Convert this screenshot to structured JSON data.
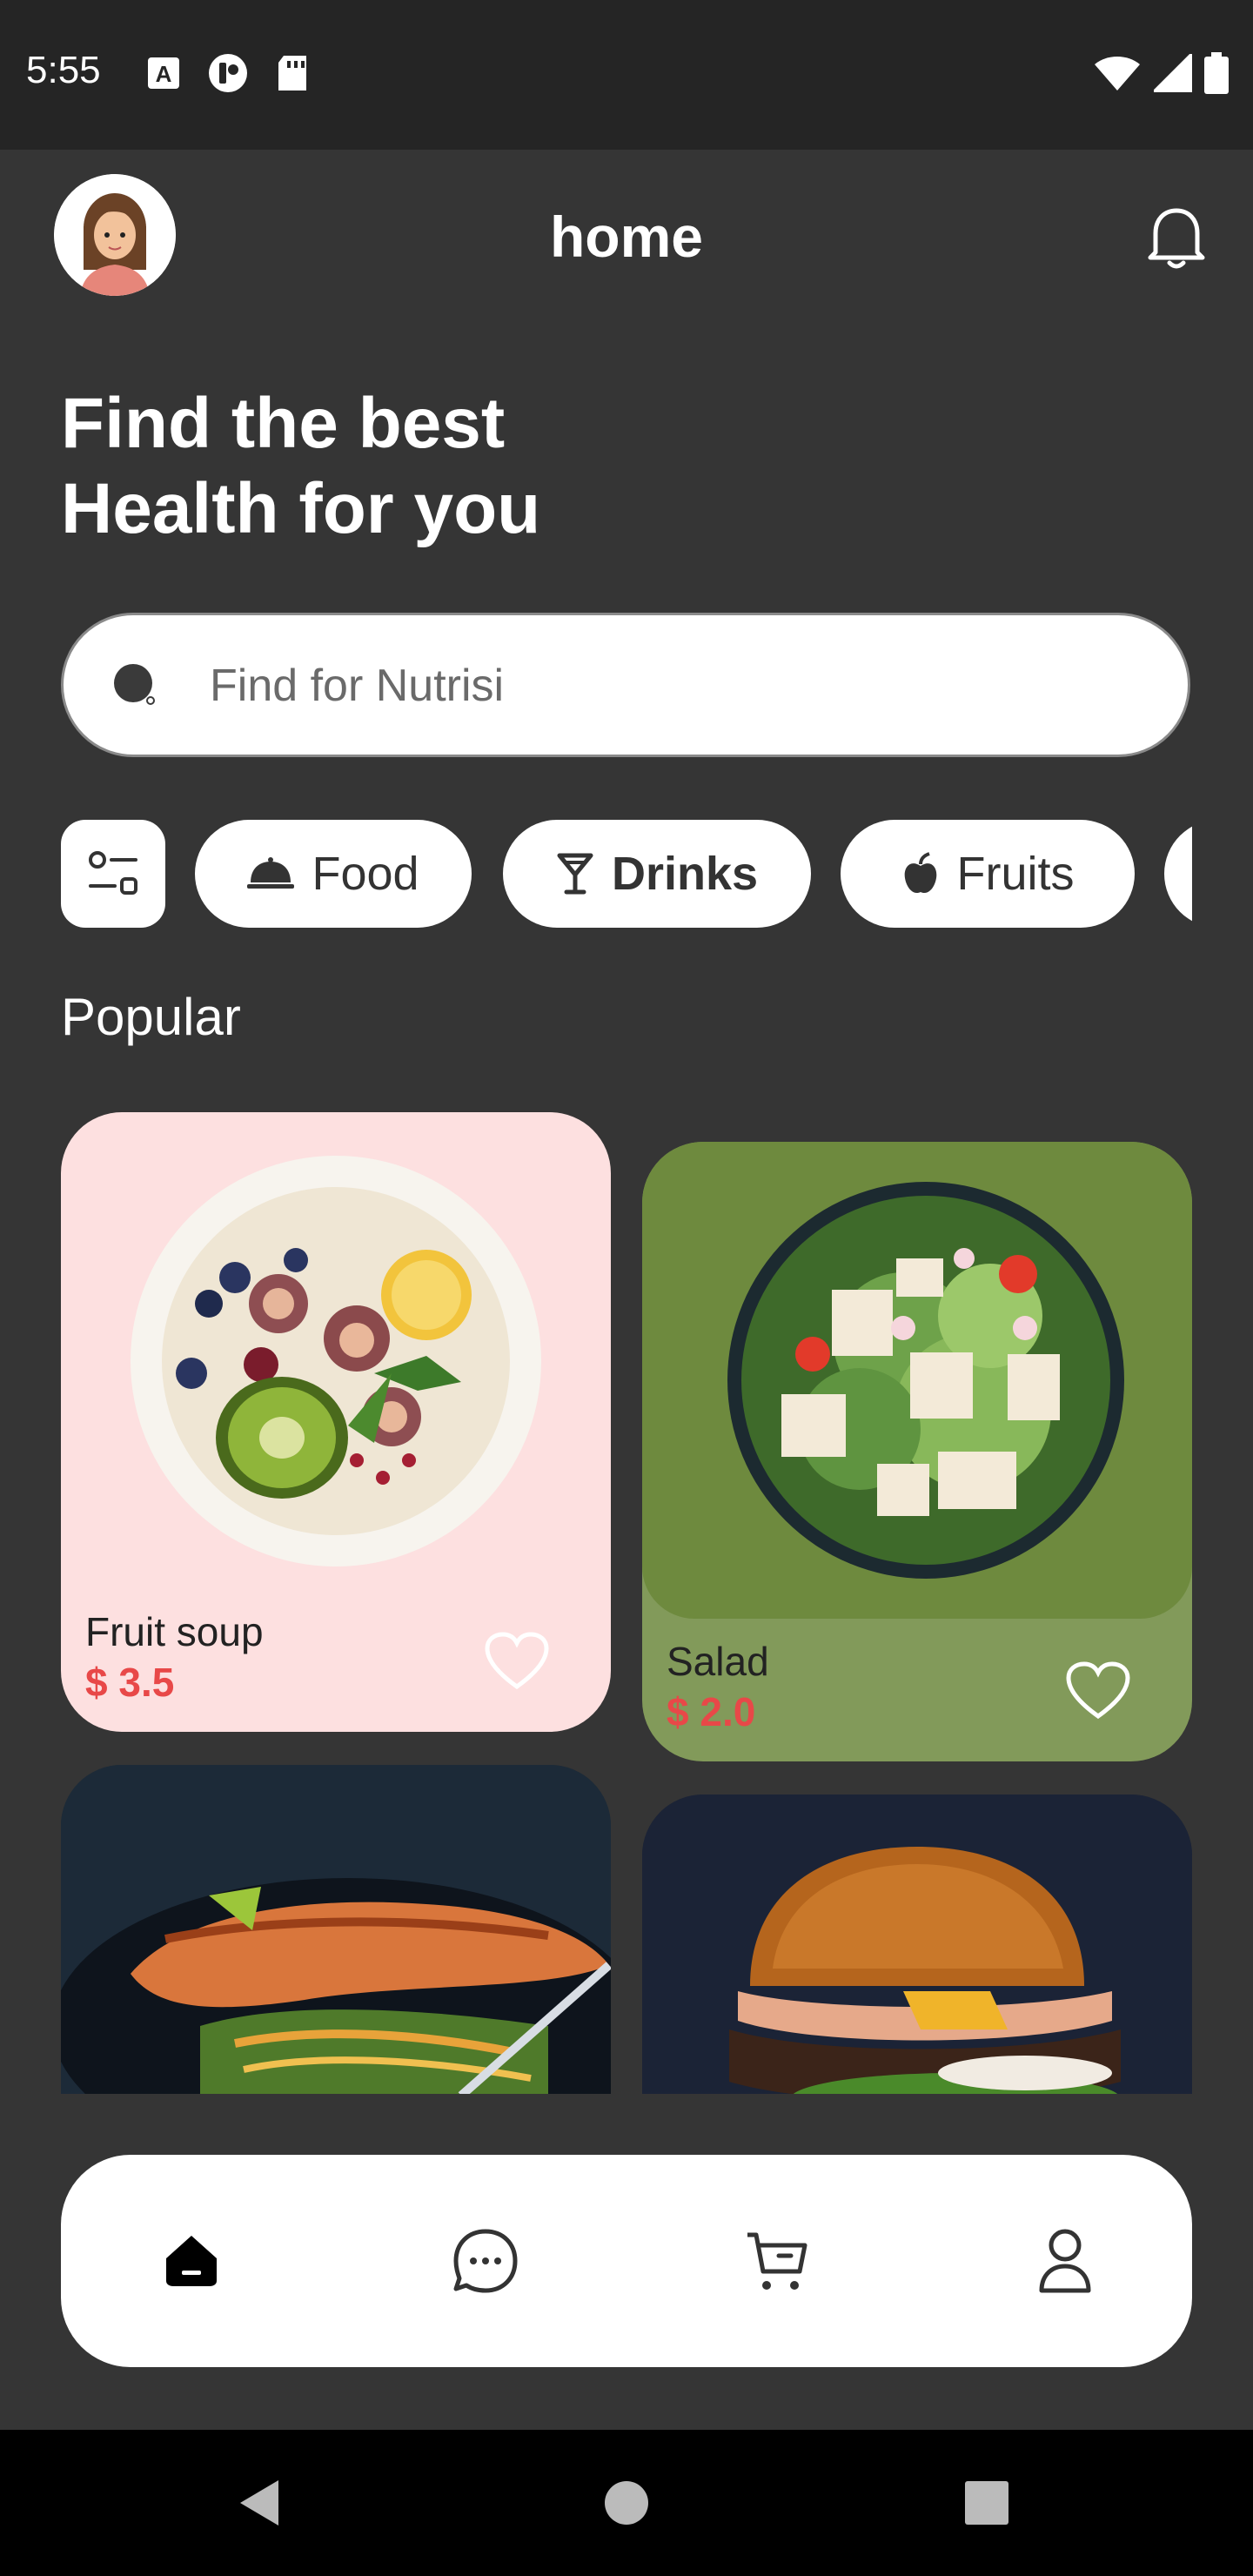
{
  "status_bar": {
    "time": "5:55",
    "left_icons": [
      "a-box-icon",
      "data-saver-icon",
      "sd-card-icon"
    ],
    "right_icons": [
      "wifi-icon",
      "signal-icon",
      "battery-icon"
    ]
  },
  "header": {
    "title": "home",
    "avatar": "user-avatar",
    "notification_icon": "bell-icon"
  },
  "hero": {
    "line1": "Find the best",
    "line2": "Health for you"
  },
  "search": {
    "placeholder": "Find for Nutrisi",
    "icon": "search-icon"
  },
  "categories": {
    "filter_icon": "filter-icon",
    "items": [
      {
        "label": "Food",
        "icon": "cloche-icon"
      },
      {
        "label": "Drinks",
        "icon": "cocktail-icon",
        "selected": true
      },
      {
        "label": "Fruits",
        "icon": "apple-icon"
      }
    ]
  },
  "popular": {
    "title": "Popular",
    "items": [
      {
        "name": "Fruit soup",
        "price": "$ 3.5",
        "bg": "#fde0e0"
      },
      {
        "name": "Salad",
        "price": "$ 2.0",
        "bg": "#829a5a"
      },
      {
        "name": "",
        "price": "",
        "bg": "#1c2a38"
      },
      {
        "name": "",
        "price": "",
        "bg": "#1b2336"
      }
    ]
  },
  "bottom_nav": {
    "items": [
      "home-icon",
      "chat-icon",
      "cart-icon",
      "profile-icon"
    ],
    "active": "home-icon"
  },
  "colors": {
    "background": "#353535",
    "accent_price": "#e84848",
    "surface": "#ffffff"
  }
}
